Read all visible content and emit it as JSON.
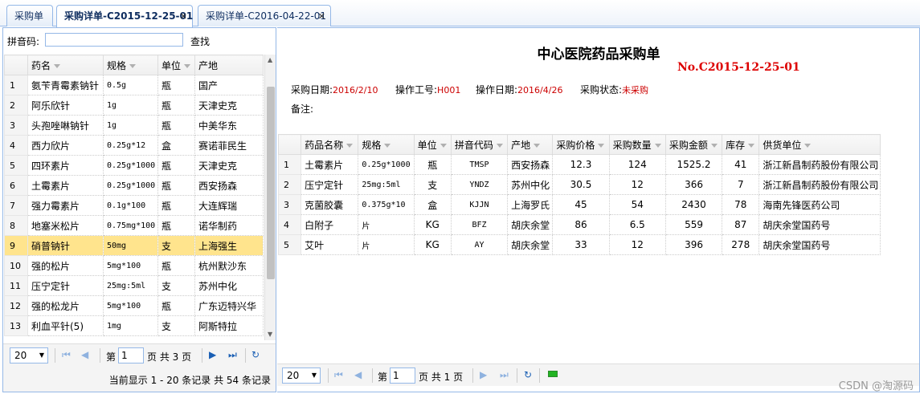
{
  "tabs": [
    {
      "label": "采购单",
      "closable": false
    },
    {
      "label": "采购详单-C2015-12-25-01",
      "closable": true
    },
    {
      "label": "采购详单-C2016-04-22-01",
      "closable": true
    }
  ],
  "search": {
    "label": "拼音码:",
    "placeholder": "",
    "button": "查找"
  },
  "left_grid": {
    "columns": [
      "药名",
      "规格",
      "单位",
      "产地"
    ],
    "rows": [
      [
        "1",
        "氨苄青霉素钠针",
        "0.5g",
        "瓶",
        "国产"
      ],
      [
        "2",
        "阿乐欣针",
        "1g",
        "瓶",
        "天津史克"
      ],
      [
        "3",
        "头孢唑啉钠针",
        "1g",
        "瓶",
        "中美华东"
      ],
      [
        "4",
        "西力欣片",
        "0.25g*12",
        "盒",
        "赛诺菲民生"
      ],
      [
        "5",
        "四环素片",
        "0.25g*1000",
        "瓶",
        "天津史克"
      ],
      [
        "6",
        "土霉素片",
        "0.25g*1000",
        "瓶",
        "西安扬森"
      ],
      [
        "7",
        "强力霉素片",
        "0.1g*100",
        "瓶",
        "大连辉瑞"
      ],
      [
        "8",
        "地塞米松片",
        "0.75mg*100",
        "瓶",
        "诺华制药"
      ],
      [
        "9",
        "硝普钠针",
        "50mg",
        "支",
        "上海强生"
      ],
      [
        "10",
        "强的松片",
        "5mg*100",
        "瓶",
        "杭州默沙东"
      ],
      [
        "11",
        "压宁定针",
        "25mg:5ml",
        "支",
        "苏州中化"
      ],
      [
        "12",
        "强的松龙片",
        "5mg*100",
        "瓶",
        "广东迈特兴华"
      ],
      [
        "13",
        "利血平针(5)",
        "1mg",
        "支",
        "阿斯特拉"
      ]
    ],
    "selected_row": 9
  },
  "left_pager": {
    "page_size": "20",
    "page_label_pre": "第",
    "page": "1",
    "page_label_post": "页 共 3 页",
    "info": "当前显示 1 - 20 条记录 共 54 条记录"
  },
  "doc": {
    "title": "中心医院药品采购单",
    "number": "No.C2015-12-25-01",
    "purchase_date_label": "采购日期:",
    "purchase_date": "2016/2/10",
    "operator_label": "操作工号:",
    "operator": "H001",
    "op_date_label": "操作日期:",
    "op_date": "2016/4/26",
    "status_label": "采购状态:",
    "status": "未采购",
    "remark_label": "备注:"
  },
  "right_grid": {
    "columns": [
      "药品名称",
      "规格",
      "单位",
      "拼音代码",
      "产地",
      "采购价格",
      "采购数量",
      "采购金额",
      "库存",
      "供货单位"
    ],
    "rows": [
      [
        "1",
        "土霉素片",
        "0.25g*1000",
        "瓶",
        "TMSP",
        "西安扬森",
        "12.3",
        "124",
        "1525.2",
        "41",
        "浙江新昌制药股份有限公司"
      ],
      [
        "2",
        "压宁定针",
        "25mg:5ml",
        "支",
        "YNDZ",
        "苏州中化",
        "30.5",
        "12",
        "366",
        "7",
        "浙江新昌制药股份有限公司"
      ],
      [
        "3",
        "克菌胶囊",
        "0.375g*10",
        "盒",
        "KJJN",
        "上海罗氏",
        "45",
        "54",
        "2430",
        "78",
        "海南先锋医药公司"
      ],
      [
        "4",
        "白附子",
        "片",
        "KG",
        "BFZ",
        "胡庆余堂",
        "86",
        "6.5",
        "559",
        "87",
        "胡庆余堂国药号"
      ],
      [
        "5",
        "艾叶",
        "片",
        "KG",
        "AY",
        "胡庆余堂",
        "33",
        "12",
        "396",
        "278",
        "胡庆余堂国药号"
      ]
    ]
  },
  "right_pager": {
    "page_size": "20",
    "page_label_pre": "第",
    "page": "1",
    "page_label_post": "页 共 1 页"
  },
  "watermark": "CSDN @淘源码",
  "colors": {
    "accent": "#95b8e7",
    "selected_row": "#ffe48d",
    "highlight": "#cc0000"
  }
}
